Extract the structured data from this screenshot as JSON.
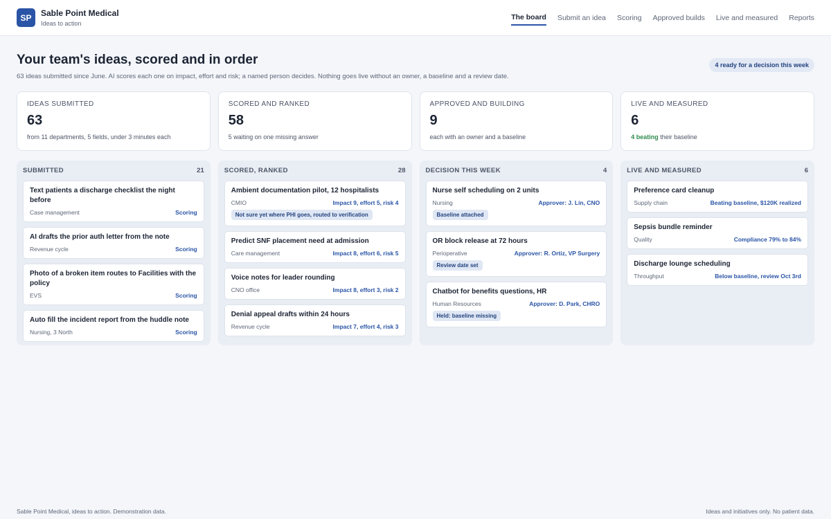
{
  "brand": {
    "logo": "SP",
    "name": "Sable Point Medical",
    "tagline": "Ideas to action",
    "accent": "#2a54a6"
  },
  "nav": [
    {
      "label": "The board",
      "active": true
    },
    {
      "label": "Submit an idea"
    },
    {
      "label": "Scoring"
    },
    {
      "label": "Approved builds"
    },
    {
      "label": "Live and measured"
    },
    {
      "label": "Reports"
    }
  ],
  "page": {
    "title": "Your team's ideas, scored and in order",
    "subtitle": "63 ideas submitted since June. AI scores each one on impact, effort and risk; a named person decides. Nothing goes live without an owner, a baseline and a review date.",
    "badge": "4 ready for a decision this week"
  },
  "stats": [
    {
      "label": "IDEAS SUBMITTED",
      "value": "63",
      "note": "from 11 departments, 5 fields, under 3 minutes each"
    },
    {
      "label": "SCORED AND RANKED",
      "value": "58",
      "note": "5 waiting on one missing answer"
    },
    {
      "label": "APPROVED AND BUILDING",
      "value": "9",
      "note": "each with an owner and a baseline"
    },
    {
      "label": "LIVE AND MEASURED",
      "value": "6",
      "note_strong": "4 beating",
      "note": " their baseline",
      "good_color": "#2f8a4e"
    }
  ],
  "columns": [
    {
      "title": "SUBMITTED",
      "count": "21",
      "cards": [
        {
          "title": "Text patients a discharge checklist the night before",
          "dept": "Case management",
          "right": "Scoring"
        },
        {
          "title": "AI drafts the prior auth letter from the note",
          "dept": "Revenue cycle",
          "right": "Scoring"
        },
        {
          "title": "Photo of a broken item routes to Facilities with the policy",
          "dept": "EVS",
          "right": "Scoring"
        },
        {
          "title": "Auto fill the incident report from the huddle note",
          "dept": "Nursing, 3 North",
          "right": "Scoring"
        }
      ]
    },
    {
      "title": "SCORED, RANKED",
      "count": "28",
      "cards": [
        {
          "title": "Ambient documentation pilot, 12 hospitalists",
          "dept": "CMIO",
          "right": "Impact 9, effort 5, risk 4",
          "pill": "Not sure yet where PHI goes, routed to verification"
        },
        {
          "title": "Predict SNF placement need at admission",
          "dept": "Care management",
          "right": "Impact 8, effort 6, risk 5"
        },
        {
          "title": "Voice notes for leader rounding",
          "dept": "CNO office",
          "right": "Impact 8, effort 3, risk 2"
        },
        {
          "title": "Denial appeal drafts within 24 hours",
          "dept": "Revenue cycle",
          "right": "Impact 7, effort 4, risk 3"
        }
      ]
    },
    {
      "title": "DECISION THIS WEEK",
      "count": "4",
      "cards": [
        {
          "title": "Nurse self scheduling on 2 units",
          "dept": "Nursing",
          "right": "Approver: J. Lin, CNO",
          "pill": "Baseline attached"
        },
        {
          "title": "OR block release at 72 hours",
          "dept": "Perioperative",
          "right": "Approver: R. Ortiz, VP Surgery",
          "pill": "Review date set"
        },
        {
          "title": "Chatbot for benefits questions, HR",
          "dept": "Human Resources",
          "right": "Approver: D. Park, CHRO",
          "pill": "Held: baseline missing"
        }
      ]
    },
    {
      "title": "LIVE AND MEASURED",
      "count": "6",
      "cards": [
        {
          "title": "Preference card cleanup",
          "dept": "Supply chain",
          "right": "Beating baseline, $120K realized"
        },
        {
          "title": "Sepsis bundle reminder",
          "dept": "Quality",
          "right": "Compliance 79% to 84%"
        },
        {
          "title": "Discharge lounge scheduling",
          "dept": "Throughput",
          "right": "Below baseline, review Oct 3rd"
        }
      ]
    }
  ],
  "footer": {
    "left": "Sable Point Medical, ideas to action. Demonstration data.",
    "right": "Ideas and initiatives only. No patient data."
  }
}
